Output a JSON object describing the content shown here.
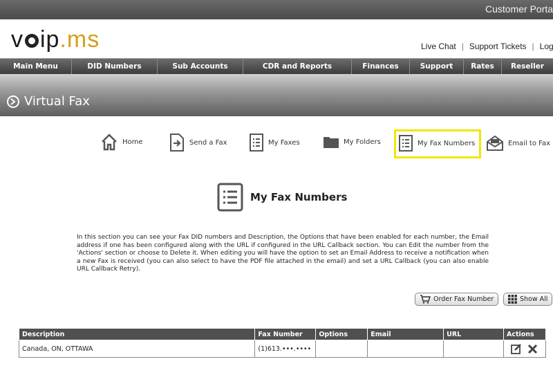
{
  "header": {
    "portal_label": "Customer Porta"
  },
  "brand": {
    "logo_v": "v",
    "logo_ip": "ip",
    "logo_dot": ".",
    "logo_ms": "ms"
  },
  "top_links": {
    "live_chat": "Live Chat",
    "support_tickets": "Support Tickets",
    "logout": "Logou",
    "separator": "|"
  },
  "nav": {
    "items": [
      {
        "label": "Main Menu"
      },
      {
        "label": "DID Numbers"
      },
      {
        "label": "Sub Accounts"
      },
      {
        "label": "CDR and Reports"
      },
      {
        "label": "Finances"
      },
      {
        "label": "Support"
      },
      {
        "label": "Rates"
      },
      {
        "label": "Reseller"
      }
    ]
  },
  "banner": {
    "title": "Virtual Fax"
  },
  "fax_nav": {
    "home": "Home",
    "send_fax": "Send a Fax",
    "my_faxes": "My Faxes",
    "my_folders": "My Folders",
    "my_fax_numbers": "My Fax Numbers",
    "email_to_fax": "Email to Fax",
    "active_item": "My Fax Numbers",
    "highlight_color": "#f2e600"
  },
  "section": {
    "title": "My Fax Numbers",
    "description": "In this section you can see your Fax DID numbers and Description, the Options that have been enabled for each number, the Email address if one has been configured along with the URL if configured in the URL Callback section. You can Edit the number from the 'Actions' section or choose to Delete it. When editing you will have the option to set an Email Address to receive a notification when a new Fax is received (you can also select to have the PDF file attached in the email) and set a URL Callback (you can also enable URL Callback Retry)."
  },
  "buttons": {
    "order_fax_number": "Order Fax Number",
    "show_all": "Show All"
  },
  "table": {
    "headers": [
      "Description",
      "Fax Number",
      "Options",
      "Email",
      "URL",
      "Actions"
    ],
    "rows": [
      {
        "description": "Canada, ON, OTTAWA",
        "fax_number": "(1)613.•••.••••",
        "options": "",
        "email": "",
        "url": ""
      }
    ]
  },
  "colors": {
    "accent_gold": "#d4a017",
    "nav_bg": "#4a4a4a",
    "table_header_bg": "#505050"
  }
}
